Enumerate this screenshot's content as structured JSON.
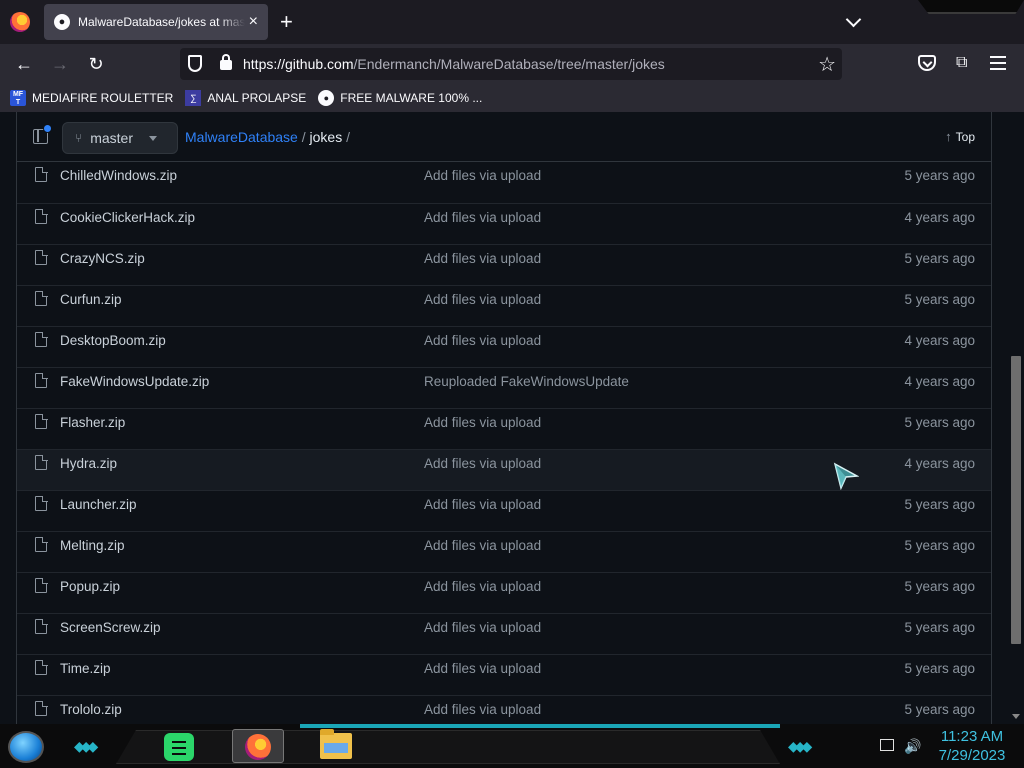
{
  "browser": {
    "tab_title": "MalwareDatabase/jokes at master",
    "new_tab": "+",
    "url_host": "https://github.com",
    "url_path": "/Endermanch/MalwareDatabase/tree/master/jokes"
  },
  "bookmarks": [
    {
      "icon": "mediafire-icon",
      "icon_text": "MF T",
      "label": "MEDIAFIRE ROULETTER"
    },
    {
      "icon": "sigma-icon",
      "icon_text": "∑",
      "label": "ANAL PROLAPSE"
    },
    {
      "icon": "github-icon",
      "icon_text": "●",
      "label": "FREE MALWARE 100% ..."
    }
  ],
  "repo_header": {
    "branch": "master",
    "repo": "MalwareDatabase",
    "separator": " / ",
    "folder": "jokes",
    "trailing": " /",
    "top_label": "Top"
  },
  "files": [
    {
      "name": "ChilledWindows.zip",
      "commit": "Add files via upload",
      "age": "5 years ago"
    },
    {
      "name": "CookieClickerHack.zip",
      "commit": "Add files via upload",
      "age": "4 years ago"
    },
    {
      "name": "CrazyNCS.zip",
      "commit": "Add files via upload",
      "age": "5 years ago"
    },
    {
      "name": "Curfun.zip",
      "commit": "Add files via upload",
      "age": "5 years ago"
    },
    {
      "name": "DesktopBoom.zip",
      "commit": "Add files via upload",
      "age": "4 years ago"
    },
    {
      "name": "FakeWindowsUpdate.zip",
      "commit": "Reuploaded FakeWindowsUpdate",
      "age": "4 years ago"
    },
    {
      "name": "Flasher.zip",
      "commit": "Add files via upload",
      "age": "5 years ago"
    },
    {
      "name": "Hydra.zip",
      "commit": "Add files via upload",
      "age": "4 years ago"
    },
    {
      "name": "Launcher.zip",
      "commit": "Add files via upload",
      "age": "5 years ago"
    },
    {
      "name": "Melting.zip",
      "commit": "Add files via upload",
      "age": "5 years ago"
    },
    {
      "name": "Popup.zip",
      "commit": "Add files via upload",
      "age": "5 years ago"
    },
    {
      "name": "ScreenScrew.zip",
      "commit": "Add files via upload",
      "age": "5 years ago"
    },
    {
      "name": "Time.zip",
      "commit": "Add files via upload",
      "age": "5 years ago"
    },
    {
      "name": "Trololo.zip",
      "commit": "Add files via upload",
      "age": "5 years ago"
    }
  ],
  "hovered_row": "Hydra.zip",
  "taskbar": {
    "time": "11:23 AM",
    "date": "7/29/2023"
  },
  "colors": {
    "link": "#2f81f7",
    "page_bg": "#0d1117",
    "taskbar_accent": "#1aa6b7"
  }
}
